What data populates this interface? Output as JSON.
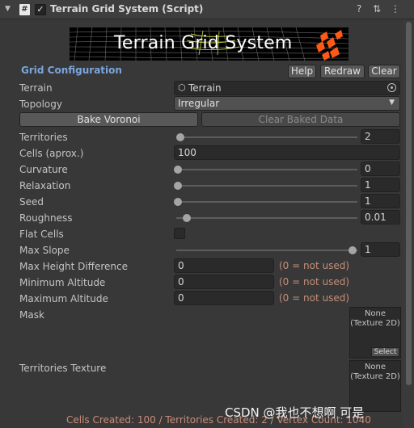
{
  "header": {
    "title": "Terrain Grid System (Script)",
    "foldout_icon": "triangle-down",
    "script_icon_glyph": "#",
    "enabled_glyph": "✓",
    "help_glyph": "?",
    "presets_glyph": "⇅",
    "menu_glyph": "⋮"
  },
  "banner": {
    "title": "Terrain Grid System"
  },
  "grid_config": {
    "section_title": "Grid Configuration",
    "help_label": "Help",
    "redraw_label": "Redraw",
    "clear_label": "Clear"
  },
  "fields": {
    "terrain_label": "Terrain",
    "terrain_value": "Terrain",
    "topology_label": "Topology",
    "topology_value": "Irregular",
    "bake_voronoi_label": "Bake Voronoi",
    "clear_baked_label": "Clear Baked Data",
    "territories_label": "Territories",
    "territories_value": "2",
    "cells_label": "Cells (aprox.)",
    "cells_value": "100",
    "curvature_label": "Curvature",
    "curvature_value": "0",
    "relaxation_label": "Relaxation",
    "relaxation_value": "1",
    "seed_label": "Seed",
    "seed_value": "1",
    "roughness_label": "Roughness",
    "roughness_value": "0.01",
    "flat_cells_label": "Flat Cells",
    "max_slope_label": "Max Slope",
    "max_slope_value": "1",
    "max_height_diff_label": "Max Height Difference",
    "max_height_diff_value": "0",
    "min_altitude_label": "Minimum Altitude",
    "min_altitude_value": "0",
    "max_altitude_label": "Maximum Altitude",
    "max_altitude_value": "0",
    "not_used_hint": "(0 = not used)",
    "mask_label": "Mask",
    "territories_texture_label": "Territories Texture",
    "texture_none_line1": "None",
    "texture_none_line2": "(Texture 2D)",
    "select_label": "Select"
  },
  "status": "Cells Created: 100 / Territories Created: 2 / Vertex Count: 1040",
  "watermark": "CSDN @我也不想啊 可是",
  "colors": {
    "accent_section": "#7aa6dc",
    "hint": "#c88d7a",
    "panel_bg": "#383838"
  }
}
